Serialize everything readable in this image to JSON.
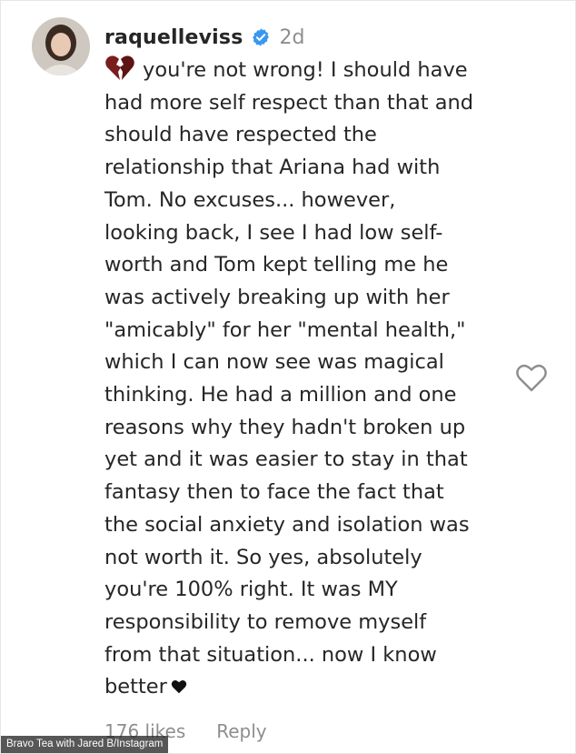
{
  "comment": {
    "username": "raquelleviss",
    "time": "2d",
    "lines": [
      "you're not wrong! I should have",
      "had more self respect than that and",
      "should have respected the",
      "relationship that Ariana had with",
      "Tom. No excuses... however,",
      "looking back, I see I had low self-",
      "worth and Tom kept telling me he",
      "was actively breaking up with her",
      "\"amicably\" for her \"mental health,\"",
      "which I can now see was magical",
      "thinking. He had a million and one",
      "reasons why they hadn't broken up",
      "yet and it was easier to stay in that",
      "fantasy then to face the fact that",
      "the social anxiety and isolation was",
      "not worth it. So yes, absolutely",
      "you're 100% right. It was MY",
      "responsibility to remove myself",
      "from that situation... now I know",
      "better"
    ],
    "leading_emoji": "broken-heart-emoji",
    "trailing_emoji": "black-heart"
  },
  "footer": {
    "likes": "176 likes",
    "reply": "Reply"
  },
  "credit": "Bravo Tea with Jared B/Instagram",
  "colors": {
    "verified": "#3897f0",
    "text": "#262626",
    "muted": "#8e8e8e",
    "emoji": "#7a1d1d"
  }
}
